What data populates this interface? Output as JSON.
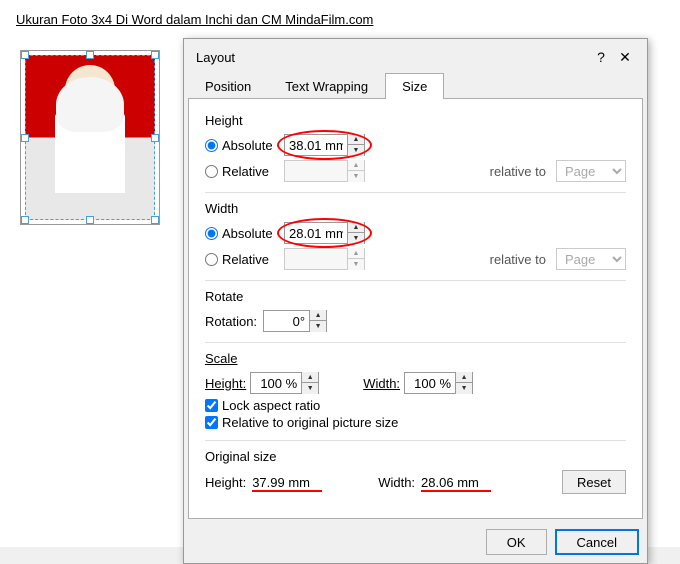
{
  "page": {
    "title": "Ukuran Foto 3x4 Di Word dalam Inchi dan CM MindaFilm.com"
  },
  "dialog": {
    "title": "Layout",
    "tabs": [
      {
        "id": "position",
        "label": "Position",
        "active": false
      },
      {
        "id": "text-wrapping",
        "label": "Text Wrapping",
        "active": false
      },
      {
        "id": "size",
        "label": "Size",
        "active": true
      }
    ],
    "height_section": {
      "label": "Height",
      "absolute_label": "Absolute",
      "absolute_value": "38.01 mm",
      "relative_label": "Relative",
      "relative_to_label": "relative to",
      "page_label": "Page"
    },
    "width_section": {
      "label": "Width",
      "absolute_label": "Absolute",
      "absolute_value": "28.01 mm",
      "relative_label": "Relative",
      "relative_to_label": "relative to",
      "page_label": "Page"
    },
    "rotate_section": {
      "label": "Rotate",
      "rotation_label": "Rotation:",
      "rotation_value": "0°"
    },
    "scale_section": {
      "label": "Scale",
      "height_label": "Height:",
      "height_value": "100 %",
      "width_label": "Width:",
      "width_value": "100 %",
      "lock_label": "Lock aspect ratio",
      "relative_label": "Relative to original picture size"
    },
    "original_section": {
      "label": "Original size",
      "height_label": "Height:",
      "height_value": "37.99 mm",
      "width_label": "Width:",
      "width_value": "28.06 mm",
      "reset_label": "Reset"
    },
    "footer": {
      "ok_label": "OK",
      "cancel_label": "Cancel"
    }
  }
}
